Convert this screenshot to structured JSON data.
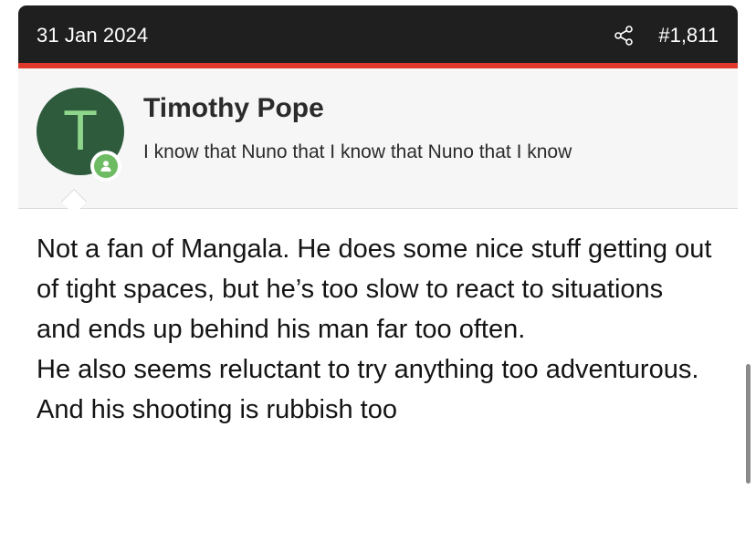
{
  "post": {
    "date": "31 Jan 2024",
    "number": "#1,811",
    "colors": {
      "header_bg": "#1f1f1f",
      "accent": "#e0382b",
      "avatar_bg": "#2d5b3c",
      "avatar_letter": "#8ed68c",
      "online": "#6dbb62"
    }
  },
  "user": {
    "avatar_letter": "T",
    "name": "Timothy Pope",
    "title": "I know that Nuno that I know that Nuno that I know"
  },
  "message": {
    "lines": [
      "Not a fan of Mangala. He does some nice stuff getting out of tight spaces, but he’s too slow to react to situations and ends up behind his man far too often.",
      "He also seems reluctant to try anything too adventurous.",
      "And his shooting is rubbish too"
    ]
  },
  "icons": {
    "share": "share-icon",
    "online": "user-online-icon"
  }
}
